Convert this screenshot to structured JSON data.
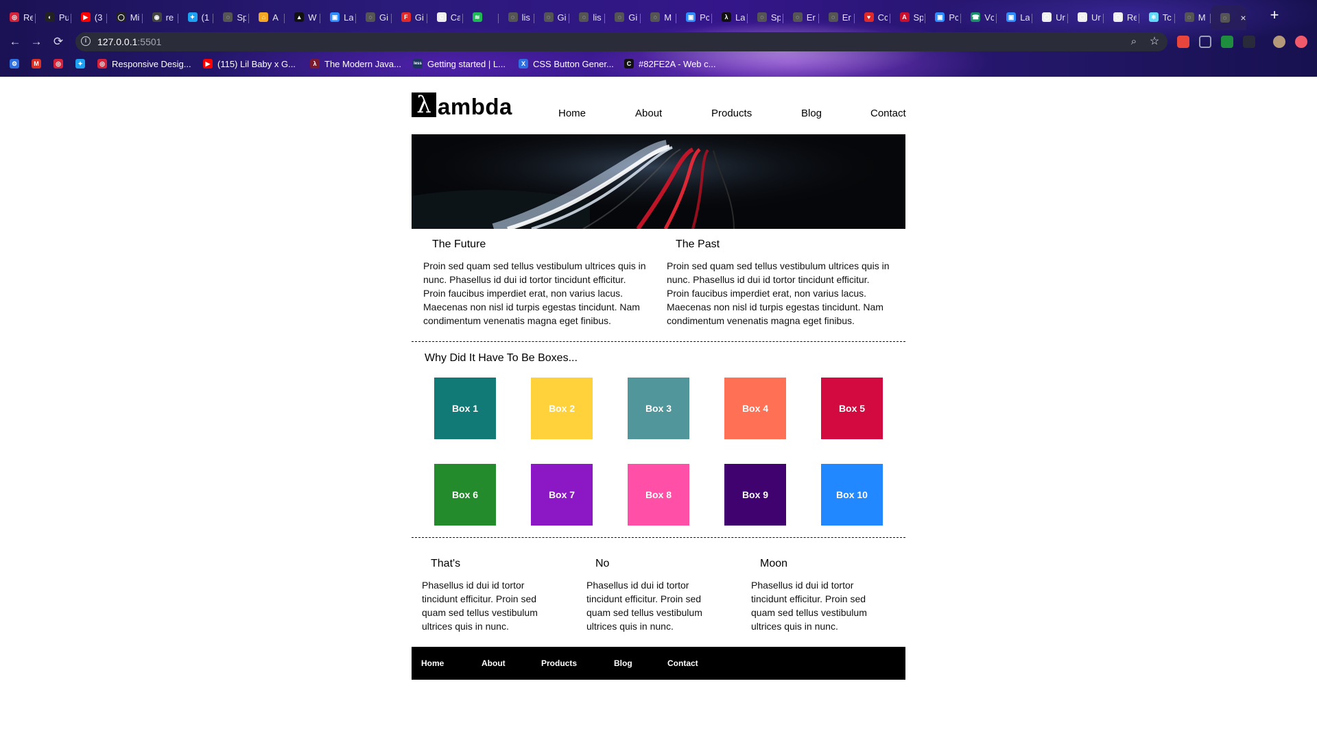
{
  "browser": {
    "tabs": [
      {
        "title": "Re",
        "color": "#d6213a",
        "glyph": "◎"
      },
      {
        "title": "Pu",
        "color": "#222",
        "glyph": "◐"
      },
      {
        "title": "(3",
        "color": "#ff0000",
        "glyph": "▶"
      },
      {
        "title": "Mi",
        "color": "#222",
        "glyph": "◯"
      },
      {
        "title": "re",
        "color": "#444",
        "glyph": "◉"
      },
      {
        "title": "(1",
        "color": "#1da1f2",
        "glyph": "✦"
      },
      {
        "title": "Sp",
        "color": "#555",
        "glyph": "◌"
      },
      {
        "title": "A",
        "color": "#f5a623",
        "glyph": "⌂"
      },
      {
        "title": "W",
        "color": "#111",
        "glyph": "▲"
      },
      {
        "title": "La",
        "color": "#2d8cff",
        "glyph": "▣"
      },
      {
        "title": "Gi",
        "color": "#555",
        "glyph": "◌"
      },
      {
        "title": "Gi",
        "color": "#e02a2a",
        "glyph": "F"
      },
      {
        "title": "Ca",
        "color": "#eee",
        "glyph": "C"
      },
      {
        "title": "",
        "color": "#1db954",
        "glyph": "≋"
      },
      {
        "title": "lis",
        "color": "#555",
        "glyph": "◌"
      },
      {
        "title": "Gi",
        "color": "#555",
        "glyph": "◌"
      },
      {
        "title": "lis",
        "color": "#555",
        "glyph": "◌"
      },
      {
        "title": "Gi",
        "color": "#555",
        "glyph": "◌"
      },
      {
        "title": "M",
        "color": "#555",
        "glyph": "◌"
      },
      {
        "title": "Pc",
        "color": "#2d8cff",
        "glyph": "▣"
      },
      {
        "title": "La",
        "color": "#111",
        "glyph": "λ"
      },
      {
        "title": "Sp",
        "color": "#555",
        "glyph": "◌"
      },
      {
        "title": "Er",
        "color": "#555",
        "glyph": "◌"
      },
      {
        "title": "Er",
        "color": "#555",
        "glyph": "◌"
      },
      {
        "title": "Cc",
        "color": "#e02a2a",
        "glyph": "♥"
      },
      {
        "title": "Sp",
        "color": "#c8102e",
        "glyph": "A"
      },
      {
        "title": "Pc",
        "color": "#2d8cff",
        "glyph": "▣"
      },
      {
        "title": "Vc",
        "color": "#1a8f6a",
        "glyph": "☎"
      },
      {
        "title": "La",
        "color": "#2d8cff",
        "glyph": "▣"
      },
      {
        "title": "Ur",
        "color": "#eee",
        "glyph": "⬡"
      },
      {
        "title": "Ur",
        "color": "#eee",
        "glyph": "⬡"
      },
      {
        "title": "Re",
        "color": "#eee",
        "glyph": "⬡"
      },
      {
        "title": "Tc",
        "color": "#61dafb",
        "glyph": "⚛"
      },
      {
        "title": "M",
        "color": "#555",
        "glyph": "◌"
      },
      {
        "title": "",
        "color": "#555",
        "glyph": "◌"
      }
    ],
    "new_tab": "+",
    "close_tab": "×",
    "back": "←",
    "forward": "→",
    "reload": "⟳",
    "url_host": "127.0.0.1",
    "url_port": ":5501",
    "bookmarks": [
      {
        "title": "",
        "color": "#2f6fdf",
        "glyph": "⚙"
      },
      {
        "title": "",
        "color": "#d93025",
        "glyph": "M"
      },
      {
        "title": "",
        "color": "#d6213a",
        "glyph": "◎"
      },
      {
        "title": "",
        "color": "#1da1f2",
        "glyph": "✦"
      },
      {
        "title": "Responsive Desig...",
        "color": "#d6213a",
        "glyph": "◎"
      },
      {
        "title": "(115) Lil Baby x G...",
        "color": "#ff0000",
        "glyph": "▶"
      },
      {
        "title": "The Modern Java...",
        "color": "#7a1a2e",
        "glyph": "λ"
      },
      {
        "title": "Getting started | L...",
        "color": "#1d365d",
        "glyph": "less"
      },
      {
        "title": "CSS Button Gener...",
        "color": "#2f6fdf",
        "glyph": "X"
      },
      {
        "title": "#82FE2A - Web c...",
        "color": "#111",
        "glyph": "C"
      }
    ]
  },
  "site": {
    "logo_glyph": "λ",
    "logo_text": "ambda",
    "nav": [
      "Home",
      "About",
      "Products",
      "Blog",
      "Contact"
    ],
    "sections": [
      {
        "title": "The Future",
        "text": "Proin sed quam sed tellus vestibulum ultrices quis in nunc. Phasellus id dui id tortor tincidunt efficitur. Proin faucibus imperdiet erat, non varius lacus. Maecenas non nisl id turpis egestas tincidunt. Nam condimentum venenatis magna eget finibus."
      },
      {
        "title": "The Past",
        "text": "Proin sed quam sed tellus vestibulum ultrices quis in nunc. Phasellus id dui id tortor tincidunt efficitur. Proin faucibus imperdiet erat, non varius lacus. Maecenas non nisl id turpis egestas tincidunt. Nam condimentum venenatis magna eget finibus."
      }
    ],
    "boxes_title": "Why Did It Have To Be Boxes...",
    "boxes": [
      {
        "label": "Box 1",
        "color": "#127a76"
      },
      {
        "label": "Box 2",
        "color": "#ffd23c"
      },
      {
        "label": "Box 3",
        "color": "#51969a"
      },
      {
        "label": "Box 4",
        "color": "#ff7055"
      },
      {
        "label": "Box 5",
        "color": "#d30a3f"
      },
      {
        "label": "Box 6",
        "color": "#238b2c"
      },
      {
        "label": "Box 7",
        "color": "#8b18c4"
      },
      {
        "label": "Box 8",
        "color": "#ff4fa6"
      },
      {
        "label": "Box 9",
        "color": "#3f026f"
      },
      {
        "label": "Box 10",
        "color": "#2188ff"
      }
    ],
    "columns": [
      {
        "title": "That's",
        "text": "Phasellus id dui id tortor tincidunt efficitur. Proin sed quam sed tellus vestibulum ultrices quis in nunc."
      },
      {
        "title": "No",
        "text": "Phasellus id dui id tortor tincidunt efficitur. Proin sed quam sed tellus vestibulum ultrices quis in nunc."
      },
      {
        "title": "Moon",
        "text": "Phasellus id dui id tortor tincidunt efficitur. Proin sed quam sed tellus vestibulum ultrices quis in nunc."
      }
    ],
    "footer_nav": [
      "Home",
      "About",
      "Products",
      "Blog",
      "Contact"
    ]
  }
}
